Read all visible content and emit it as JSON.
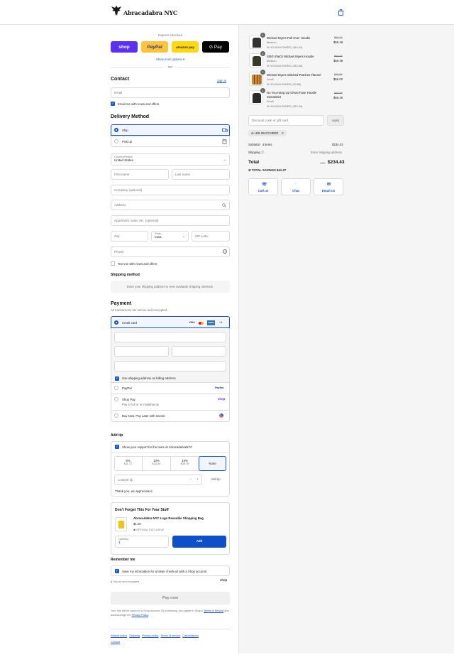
{
  "header": {
    "brand": "Abracadabra NYC"
  },
  "express": {
    "label": "Express checkout",
    "buttons": [
      {
        "label": "shop",
        "bg": "#5a31f4",
        "color": "#ffffff"
      },
      {
        "label": "PayPal",
        "bg": "#ffc439",
        "color": "#253b80"
      },
      {
        "label": "amazon pay",
        "bg": "#ffd814",
        "color": "#222222"
      },
      {
        "label": "G Pay",
        "bg": "#000000",
        "color": "#ffffff"
      }
    ],
    "more_options": "Show more options ▾",
    "or": "OR"
  },
  "contact": {
    "title": "Contact",
    "sign_in": "Sign in",
    "email_placeholder": "Email",
    "email_news": "Email me with news and offers"
  },
  "delivery": {
    "title": "Delivery Method",
    "ship": "Ship",
    "pickup": "Pick up",
    "country_label": "Country/Region",
    "country_value": "United States",
    "first_name": "First name",
    "last_name": "Last name",
    "company": "Company (optional)",
    "address": "Address",
    "apartment": "Apartment, suite, etc. (optional)",
    "city": "City",
    "state_label": "State",
    "state_value": "Iowa",
    "zip": "ZIP code",
    "phone": "Phone",
    "text_news": "Text me with news and offers"
  },
  "shipping_method": {
    "title": "Shipping method",
    "message": "Enter your shipping address to view available shipping methods."
  },
  "payment": {
    "title": "Payment",
    "subtitle": "All transactions are secure and encrypted.",
    "credit_card": "Credit card",
    "card_brands": [
      "VISA",
      "MC",
      "AMEX"
    ],
    "more_cards": "+4",
    "billing_same": "Use shipping address as billing address",
    "paypal": "PayPal",
    "paypal_logo": "PayPal",
    "shop_pay": "Shop Pay",
    "shop_pay_sub": "Pay in full or in installments",
    "shop_logo": "shop",
    "sezzle": "Buy Now, Pay Later with Sezzle"
  },
  "tip": {
    "title": "Add tip",
    "support": "Show your support for the team at AbracadabraNYC",
    "options": [
      {
        "pct": "5%",
        "amt": "$11.72"
      },
      {
        "pct": "10%",
        "amt": "$23.44"
      },
      {
        "pct": "15%",
        "amt": "$35.16"
      },
      {
        "pct": "None",
        "amt": ""
      }
    ],
    "custom_placeholder": "Custom tip",
    "add_button": "Add tip",
    "thanks": "Thank you, we appreciate it."
  },
  "upsell": {
    "title": "Don't Forget This For Your Stuff",
    "product": "Abracadabra NYC Logo Reusable Shopping Bag",
    "price": "$1.00",
    "badge": "OFFICIAL EXCLUSIVE",
    "qty_label": "Quantity",
    "qty_value": "1",
    "add": "Add"
  },
  "remember": {
    "title": "Remember me",
    "save": "Save my information for a faster checkout with a Shop account",
    "secure": "Secure and encrypted",
    "shop_logo": "shop"
  },
  "pay_now": "Pay now",
  "legal": {
    "line1": "Your info will be saved to a Shop account. By continuing, you agree to Shop's",
    "terms": "Terms of Service",
    "and": " and acknowledge the ",
    "privacy": "Privacy Policy",
    "end": "."
  },
  "footer_links": [
    "Refund policy",
    "Shipping",
    "Privacy policy",
    "Terms of service",
    "Cancellations",
    "Contact"
  ],
  "cart": {
    "items": [
      {
        "qty": "1",
        "name": "Michael Myers Pull Over Hoodie",
        "variant": "Medium",
        "discount": "HOLIDAYCHEER (-$10.00)",
        "old": "$69.48",
        "price": "$59.48",
        "color": "#333333"
      },
      {
        "qty": "1",
        "name": "Stitch Patch Michael Myers Hoodie",
        "variant": "Medium",
        "discount": "HOLIDAYCHEER (-$10.48)",
        "old": "$69.96",
        "price": "$59.48",
        "color": "#3a3a2a"
      },
      {
        "qty": "1",
        "name": "Michael Myers Stitched Patches Flannel",
        "variant": "Small",
        "discount": "HOLIDAYCHEER (-$9.88)",
        "old": "$65.88",
        "price": "$56.00",
        "color": "#d08a2a"
      },
      {
        "qty": "1",
        "name": "No You Hang Up Ghost Face Hoodie Sweatshirt",
        "variant": "Small",
        "discount": "HOLIDAYCHEER (-$10.49)",
        "old": "$69.98",
        "price": "$59.49",
        "color": "#2a2a2a"
      }
    ],
    "discount_placeholder": "Discount code or gift card",
    "apply": "Apply",
    "code_tag": "HOLIDAYCHEER",
    "subtotal_label": "Subtotal · 4 items",
    "subtotal": "$234.43",
    "shipping_label": "Shipping",
    "shipping_value": "Enter shipping address",
    "total_label": "Total",
    "currency": "USD",
    "total": "$234.43",
    "savings_label": "TOTAL SAVINGS",
    "savings": "$41.37",
    "contact_buttons": [
      "Call us",
      "Chat",
      "Email us"
    ]
  }
}
